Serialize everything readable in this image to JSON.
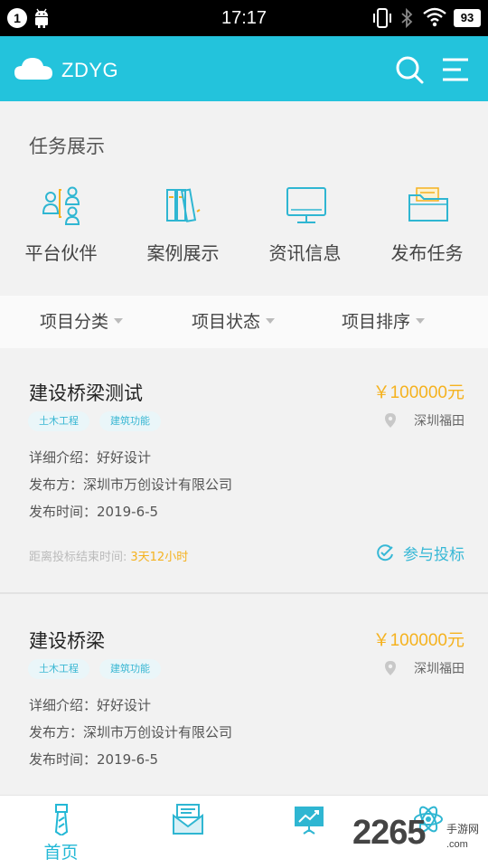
{
  "status_bar": {
    "notification_count": "1",
    "time": "17:17",
    "battery": "93",
    "icons": [
      "notification-badge",
      "android-icon",
      "vibrate-icon",
      "bluetooth-icon",
      "wifi-icon",
      "battery-icon"
    ]
  },
  "header": {
    "app_name": "ZDYG",
    "background_color": "#23c3dc",
    "icons": [
      "cloud-logo-icon",
      "search-icon",
      "menu-icon"
    ]
  },
  "task_section": {
    "title": "任务展示",
    "items": [
      {
        "label": "平台伙伴",
        "icon": "partners-icon"
      },
      {
        "label": "案例展示",
        "icon": "books-icon"
      },
      {
        "label": "资讯信息",
        "icon": "monitor-icon"
      },
      {
        "label": "发布任务",
        "icon": "folder-icon"
      }
    ]
  },
  "filters": [
    {
      "label": "项目分类"
    },
    {
      "label": "项目状态"
    },
    {
      "label": "项目排序"
    }
  ],
  "projects": [
    {
      "title": "建设桥梁测试",
      "price": "￥100000元",
      "tags": [
        "土木工程",
        "建筑功能"
      ],
      "location": "深圳福田",
      "detail": "详细介绍：好好设计",
      "publisher": "发布方：深圳市万创设计有限公司",
      "publish_time": "发布时间：2019-6-5",
      "deadline_label": "距离投标结束时间:",
      "deadline_remaining": "3天12小时",
      "action": "参与投标"
    },
    {
      "title": "建设桥梁",
      "price": "￥100000元",
      "tags": [
        "土木工程",
        "建筑功能"
      ],
      "location": "深圳福田",
      "detail": "详细介绍：好好设计",
      "publisher": "发布方：深圳市万创设计有限公司",
      "publish_time": "发布时间：2019-6-5"
    }
  ],
  "tabbar": {
    "tabs": [
      {
        "label": "首页",
        "icon": "home-tie-icon",
        "active": true
      },
      {
        "label": "",
        "icon": "mail-icon"
      },
      {
        "label": "",
        "icon": "presentation-chart-icon"
      },
      {
        "label": "",
        "icon": "atom-icon"
      }
    ],
    "accent_color": "#23b8d6"
  },
  "watermark": {
    "number": "2265",
    "text": "手游网",
    "domain": ".com"
  },
  "colors": {
    "price": "#f5b21f",
    "tag_text": "#39b7d3",
    "page_bg": "#f2f2f2"
  }
}
